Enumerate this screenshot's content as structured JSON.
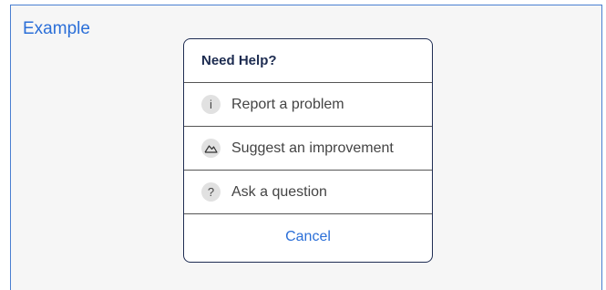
{
  "example": {
    "label": "Example"
  },
  "menu": {
    "title": "Need Help?",
    "items": [
      {
        "icon": "info-icon",
        "icon_glyph": "i",
        "label": "Report a problem"
      },
      {
        "icon": "mountain-icon",
        "icon_glyph": "",
        "label": "Suggest an improvement"
      },
      {
        "icon": "question-icon",
        "icon_glyph": "?",
        "label": "Ask a question"
      }
    ],
    "cancel_label": "Cancel"
  },
  "colors": {
    "accent": "#2b6fd8",
    "title": "#1c2b50",
    "text": "#444444",
    "frame_border": "#4a7fd1",
    "frame_background": "#f6f6f6"
  }
}
